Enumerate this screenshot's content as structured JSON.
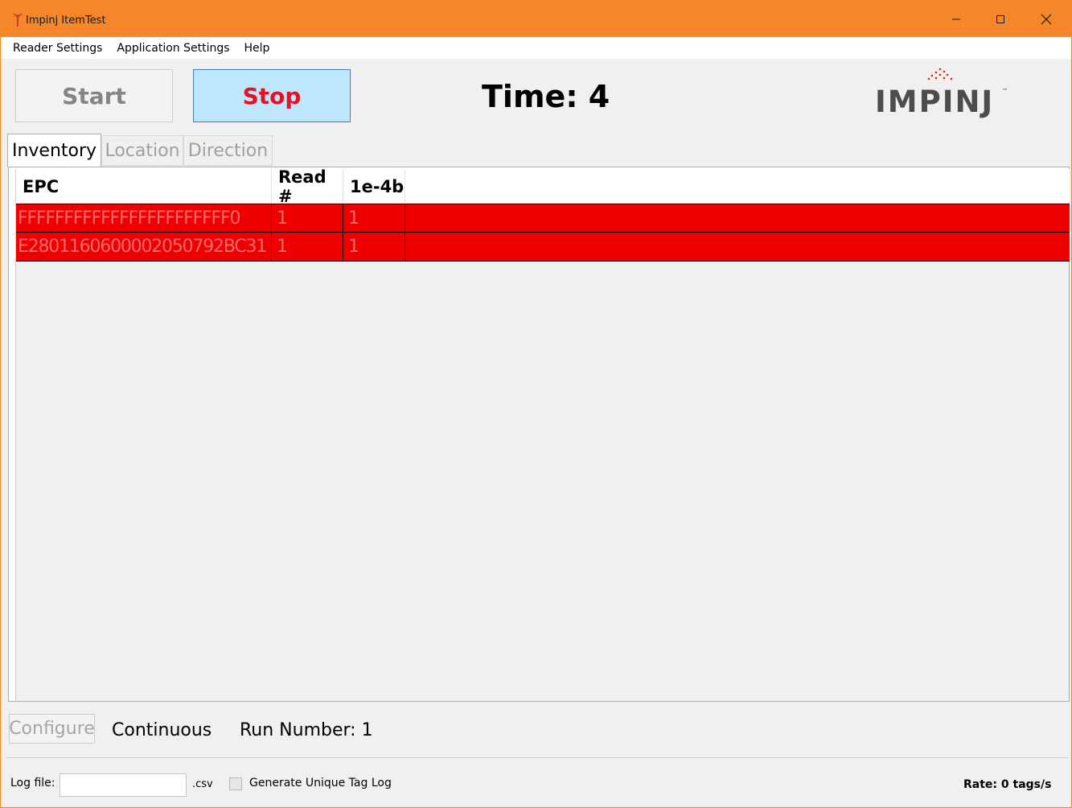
{
  "window": {
    "title": "Impinj ItemTest",
    "icon": "antenna-icon",
    "controls": {
      "minimize": "—",
      "maximize": "☐",
      "close": "✕"
    }
  },
  "menu": {
    "items": [
      "Reader Settings",
      "Application Settings",
      "Help"
    ]
  },
  "toolbar": {
    "start_label": "Start",
    "stop_label": "Stop",
    "time_text": "Time: 4",
    "logo_text": "IMPINJ",
    "logo_tm": "™"
  },
  "tabs": [
    {
      "label": "Inventory",
      "active": true
    },
    {
      "label": "Location",
      "active": false
    },
    {
      "label": "Direction",
      "active": false
    }
  ],
  "table": {
    "columns": [
      "EPC",
      "Read #",
      "1e-4b"
    ],
    "rows": [
      {
        "epc": "FFFFFFFFFFFFFFFFFFFFFFF0",
        "read": "1",
        "rssi": "1"
      },
      {
        "epc": "E2801160600002050792BC31",
        "read": "1",
        "rssi": "1"
      }
    ],
    "row_color": "#ee0000"
  },
  "config": {
    "configure_label": "Configure",
    "mode_text": "Continuous",
    "run_text": "Run Number: 1"
  },
  "status": {
    "log_label": "Log file:",
    "log_value": "",
    "csv_suffix": ".csv",
    "unique_log_label": "Generate Unique Tag Log",
    "unique_log_checked": false,
    "rate_text": "Rate: 0 tags/s"
  },
  "colors": {
    "titlebar": "#f5862a",
    "stop_text": "#e81123",
    "stop_bg": "#bee6fd",
    "logo_dots": "#d62027"
  }
}
